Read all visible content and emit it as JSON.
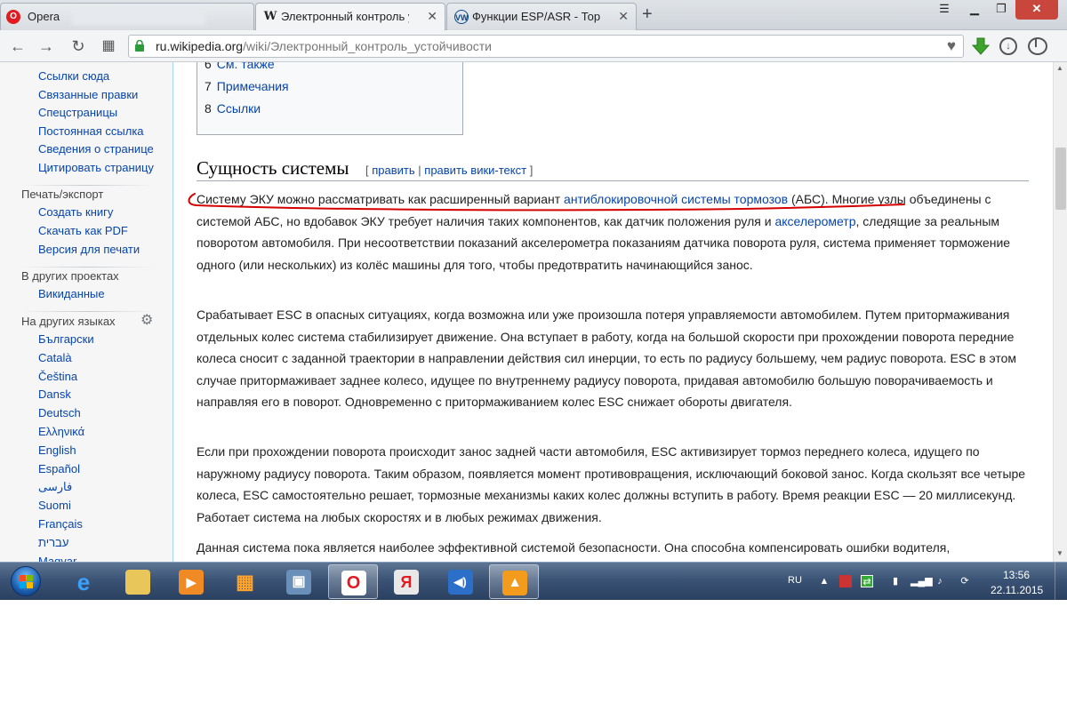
{
  "browser": {
    "tabs": [
      {
        "label": "Opera",
        "favicon": "opera-logo-icon"
      },
      {
        "label": "Электронный контроль ус",
        "favicon": "wikipedia-w-icon"
      },
      {
        "label": "Функции ESP/ASR - Тормо",
        "favicon": "volkswagen-logo-icon"
      }
    ],
    "new_tab": "+",
    "url_host": "ru.wikipedia.org",
    "url_path": "/wiki/Электронный_контроль_устойчивости"
  },
  "sidebar": {
    "tools": [
      "Ссылки сюда",
      "Связанные правки",
      "Спецстраницы",
      "Постоянная ссылка",
      "Сведения о странице",
      "Цитировать страницу"
    ],
    "print_heading": "Печать/экспорт",
    "print": [
      "Создать книгу",
      "Скачать как PDF",
      "Версия для печати"
    ],
    "projects_heading": "В других проектах",
    "projects": [
      "Викиданные"
    ],
    "languages_heading": "На других языках",
    "languages": [
      "Български",
      "Català",
      "Čeština",
      "Dansk",
      "Deutsch",
      "Ελληνικά",
      "English",
      "Español",
      "فارسی",
      "Suomi",
      "Français",
      "עברית",
      "Magyar"
    ]
  },
  "toc": [
    {
      "num": "6",
      "label": "См. также"
    },
    {
      "num": "7",
      "label": "Примечания"
    },
    {
      "num": "8",
      "label": "Ссылки"
    }
  ],
  "section": {
    "title": "Сущность системы",
    "bracket_open": "[",
    "edit": "править",
    "sep": "|",
    "edit_source": "править вики-текст",
    "bracket_close": "]"
  },
  "p1": {
    "a": "Систему ЭКУ можно рассматривать как расширенный вариант ",
    "link1": "антиблокировочной системы тормозов",
    "b": " (АБС). Многие узлы объединены с системой АБС, но вдобавок ЭКУ требует наличия таких компонентов, как датчик положения руля и ",
    "link2": "акселерометр",
    "c": ", следящие за реальным поворотом автомобиля. При несоответствии показаний акселерометра показаниям датчика поворота руля, система применяет торможение одного (или нескольких) из колёс машины для того, чтобы предотвратить начинающийся занос."
  },
  "p2": "Срабатывает ESC в опасных ситуациях, когда возможна или уже произошла потеря управляемости автомобилем. Путем притормаживания отдельных колес система стабилизирует движение. Она вступает в работу, когда на большой скорости при прохождении поворота передние колеса сносит с заданной траектории в направлении действия сил инерции, то есть по радиусу большему, чем радиус поворота. ESC в этом случае притормаживает заднее колесо, идущее по внутреннему радиусу поворота, придавая автомобилю большую поворачиваемость и направляя его в поворот. Одновременно с притормаживанием колес ESC снижает обороты двигателя.",
  "p3": "Если при прохождении поворота происходит занос задней части автомобиля, ESC активизирует тормоз переднего колеса, идущего по наружному радиусу поворота. Таким образом, появляется момент противовращения, исключающий боковой занос. Когда скользят все четыре колеса, ESC самостоятельно решает, тормозные механизмы каких колес должны вступить в работу. Время реакции ESC — 20 миллисекунд. Работает система на любых скоростях и в любых режимах движения.",
  "p4": "Данная система пока является наиболее эффективной системой безопасности. Она способна компенсировать ошибки водителя,",
  "taskbar": {
    "language": "RU",
    "time": "13:56",
    "date": "22.11.2015",
    "apps": [
      "internet-explorer-icon",
      "file-explorer-icon",
      "media-player-icon",
      "apps-grid-icon",
      "network-pc-icon",
      "opera-icon",
      "yandex-browser-icon",
      "audio-app-icon",
      "avast-icon"
    ]
  },
  "colors": {
    "link": "#0645ad",
    "annotation": "#d40000",
    "taskbar": "#3b5375"
  }
}
